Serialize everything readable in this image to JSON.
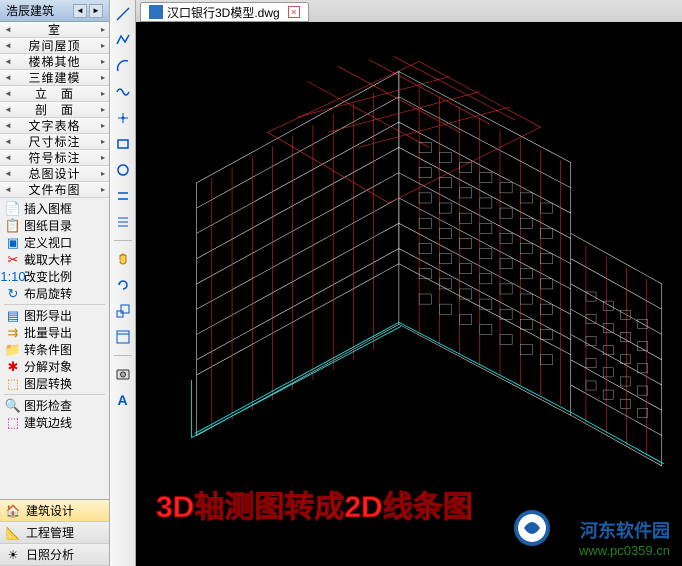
{
  "sidebar": {
    "title": "浩辰建筑",
    "tree_items": [
      "室",
      "房间屋顶",
      "楼梯其他",
      "三维建模",
      "立　面",
      "剖　面",
      "文字表格",
      "尺寸标注",
      "符号标注",
      "总图设计",
      "文件布图"
    ],
    "tools": [
      {
        "icon": "📄",
        "label": "插入图框",
        "colors": [
          "#d00",
          "#0a0"
        ]
      },
      {
        "icon": "📋",
        "label": "图纸目录",
        "colors": [
          "#d00",
          "#06c"
        ]
      },
      {
        "icon": "▣",
        "label": "定义视口",
        "colors": [
          "#06c"
        ]
      },
      {
        "icon": "✂",
        "label": "截取大样",
        "colors": [
          "#d00",
          "#0a0"
        ]
      },
      {
        "icon": "1:10",
        "label": "改变比例",
        "colors": [
          "#06c"
        ]
      },
      {
        "icon": "↻",
        "label": "布局旋转",
        "colors": [
          "#06c",
          "#d00"
        ]
      },
      {
        "icon": "▤",
        "label": "图形导出",
        "colors": [
          "#06c"
        ]
      },
      {
        "icon": "⇉",
        "label": "批量导出",
        "colors": [
          "#c80",
          "#06c"
        ]
      },
      {
        "icon": "📁",
        "label": "转条件图",
        "colors": [
          "#c80",
          "#d00"
        ]
      },
      {
        "icon": "✱",
        "label": "分解对象",
        "colors": [
          "#d00",
          "#0a0",
          "#06c"
        ]
      },
      {
        "icon": "⬚",
        "label": "图层转换",
        "colors": [
          "#c80",
          "#06c"
        ]
      },
      {
        "icon": "🔍",
        "label": "图形检查",
        "colors": [
          "#06c"
        ]
      },
      {
        "icon": "⬚",
        "label": "建筑边线",
        "colors": [
          "#b0b",
          "#06c"
        ]
      }
    ],
    "bottom_tabs": [
      {
        "icon": "🏠",
        "label": "建筑设计",
        "active": true
      },
      {
        "icon": "📐",
        "label": "工程管理",
        "active": false
      },
      {
        "icon": "☀",
        "label": "日照分析",
        "active": false
      }
    ]
  },
  "toolbar": {
    "items": [
      "line",
      "polyline",
      "arc",
      "spline",
      "point",
      "rect",
      "circle",
      "parallel",
      "offset",
      "hand",
      "rotate",
      "scale",
      "window",
      "capture",
      "text"
    ]
  },
  "tab": {
    "filename": "汉口银行3D模型.dwg"
  },
  "overlay": {
    "text": "3D轴测图转成2D线条图",
    "color": "#ff2020"
  },
  "watermark": {
    "title": "河东软件园",
    "url": "www.pc0359.cn"
  }
}
